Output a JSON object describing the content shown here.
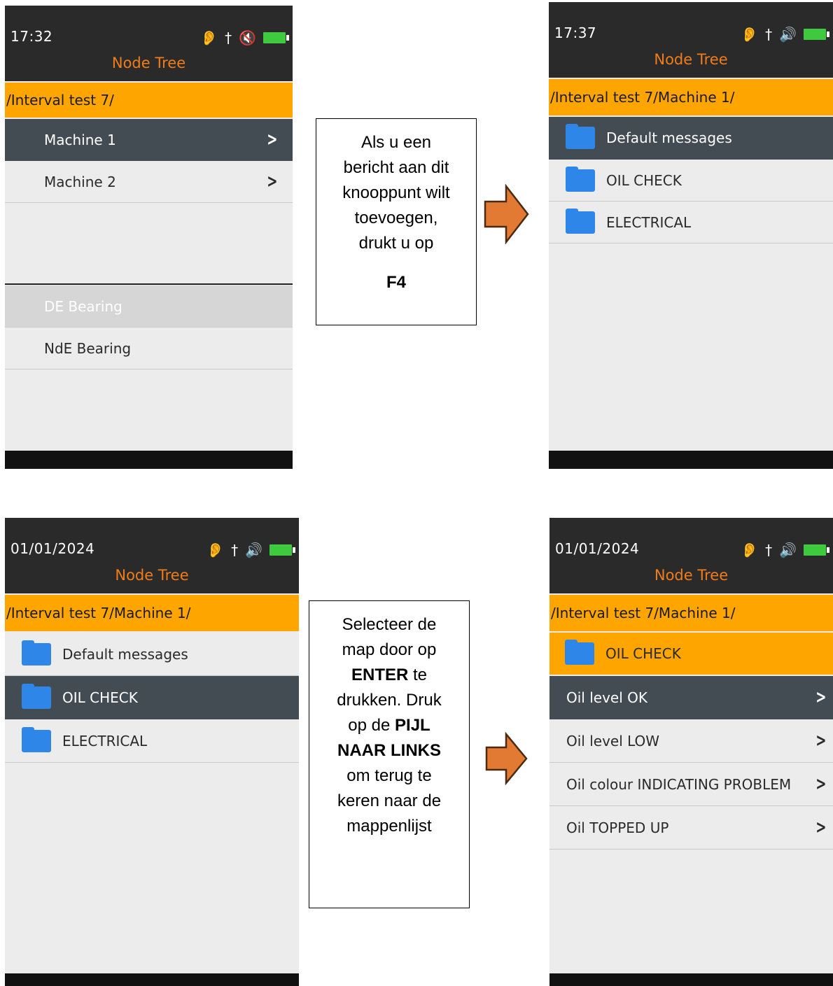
{
  "colors": {
    "accent": "#ffa500",
    "title": "#f07c1a",
    "selected": "#424c52",
    "folder": "#2d86e8",
    "battery": "#3fc93f",
    "arrow": "#e37a34"
  },
  "icons": [
    "hearing-warning-icon",
    "usb-icon",
    "speaker-muted-icon",
    "speaker-icon",
    "battery-icon",
    "folder-icon",
    "chevron-right-icon",
    "arrow-right-icon"
  ],
  "screen1": {
    "time": "17:32",
    "title": "Node Tree",
    "path": "/Interval test 7/",
    "items": [
      {
        "label": "Machine 1"
      },
      {
        "label": "Machine 2"
      }
    ],
    "sub_items": [
      {
        "label": "DE Bearing"
      },
      {
        "label": "NdE Bearing"
      }
    ]
  },
  "note1": {
    "line1": "Als u een",
    "line2": "bericht aan dit",
    "line3": "knooppunt wilt",
    "line4": "toevoegen,",
    "line5": "drukt u op",
    "key": "F4"
  },
  "screen2": {
    "time": "17:37",
    "title": "Node Tree",
    "path": "/Interval test 7/Machine 1/",
    "items": [
      {
        "label": "Default messages"
      },
      {
        "label": "OIL CHECK"
      },
      {
        "label": "ELECTRICAL"
      }
    ]
  },
  "screen3": {
    "time": "01/01/2024",
    "title": "Node Tree",
    "path": "/Interval test 7/Machine 1/",
    "items": [
      {
        "label": "Default messages"
      },
      {
        "label": "OIL CHECK"
      },
      {
        "label": "ELECTRICAL"
      }
    ]
  },
  "note2": {
    "t1": "Selecteer de",
    "t2": "map door op",
    "k1": "ENTER",
    "t3": " te",
    "t4": "drukken. Druk",
    "t5": "op de ",
    "k2": "PIJL",
    "k3": "NAAR LINKS",
    "t6": "om terug te",
    "t7": "keren naar de",
    "t8": "mappenlijst"
  },
  "screen4": {
    "time": "01/01/2024",
    "title": "Node Tree",
    "path": "/Interval test 7/Machine 1/",
    "folder": "OIL CHECK",
    "items": [
      {
        "label": "Oil level OK"
      },
      {
        "label": "Oil level LOW"
      },
      {
        "label": "Oil colour INDICATING PROBLEM"
      },
      {
        "label": "Oil TOPPED UP"
      }
    ]
  }
}
